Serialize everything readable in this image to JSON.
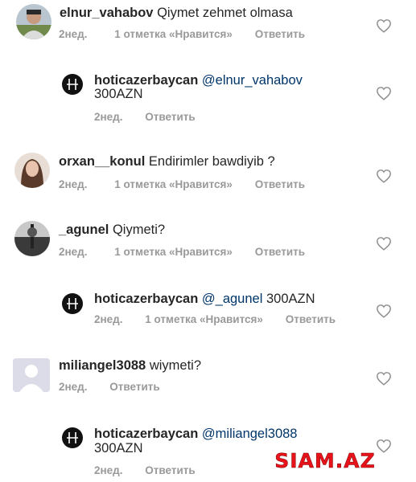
{
  "comments": [
    {
      "username": "elnur_vahabov",
      "text": "Qiymet zehmet olmasa",
      "time": "2нед.",
      "likes": "1 отметка «Нравится»",
      "reply": "Ответить",
      "avatar": "man-photo"
    },
    {
      "username": "hoticazerbaycan",
      "mention": "@elnur_vahabov",
      "text": "300AZN",
      "time": "2нед.",
      "reply": "Ответить",
      "avatar": "hotic-logo"
    },
    {
      "username": "orxan__konul",
      "text": "Endirimler bawdiyib ?",
      "time": "2нед.",
      "likes": "1 отметка «Нравится»",
      "reply": "Ответить",
      "avatar": "woman-photo"
    },
    {
      "username": "_agunel",
      "text": "Qiymeti?",
      "time": "2нед.",
      "likes": "1 отметка «Нравится»",
      "reply": "Ответить",
      "avatar": "bw-photo"
    },
    {
      "username": "hoticazerbaycan",
      "mention": "@_agunel",
      "text": "300AZN",
      "time": "2нед.",
      "likes": "1 отметка «Нравится»",
      "reply": "Ответить",
      "avatar": "hotic-logo"
    },
    {
      "username": "miliangel3088",
      "text": "wiymeti?",
      "time": "2нед.",
      "reply": "Ответить",
      "avatar": "default-avatar"
    },
    {
      "username": "hoticazerbaycan",
      "mention": "@miliangel3088",
      "text": "300AZN",
      "time": "2нед.",
      "reply": "Ответить",
      "avatar": "hotic-logo"
    }
  ],
  "watermark": "SIAM.AZ",
  "colors": {
    "text": "#262626",
    "mention": "#003569",
    "meta": "#999999",
    "watermark": "#e8121b"
  }
}
